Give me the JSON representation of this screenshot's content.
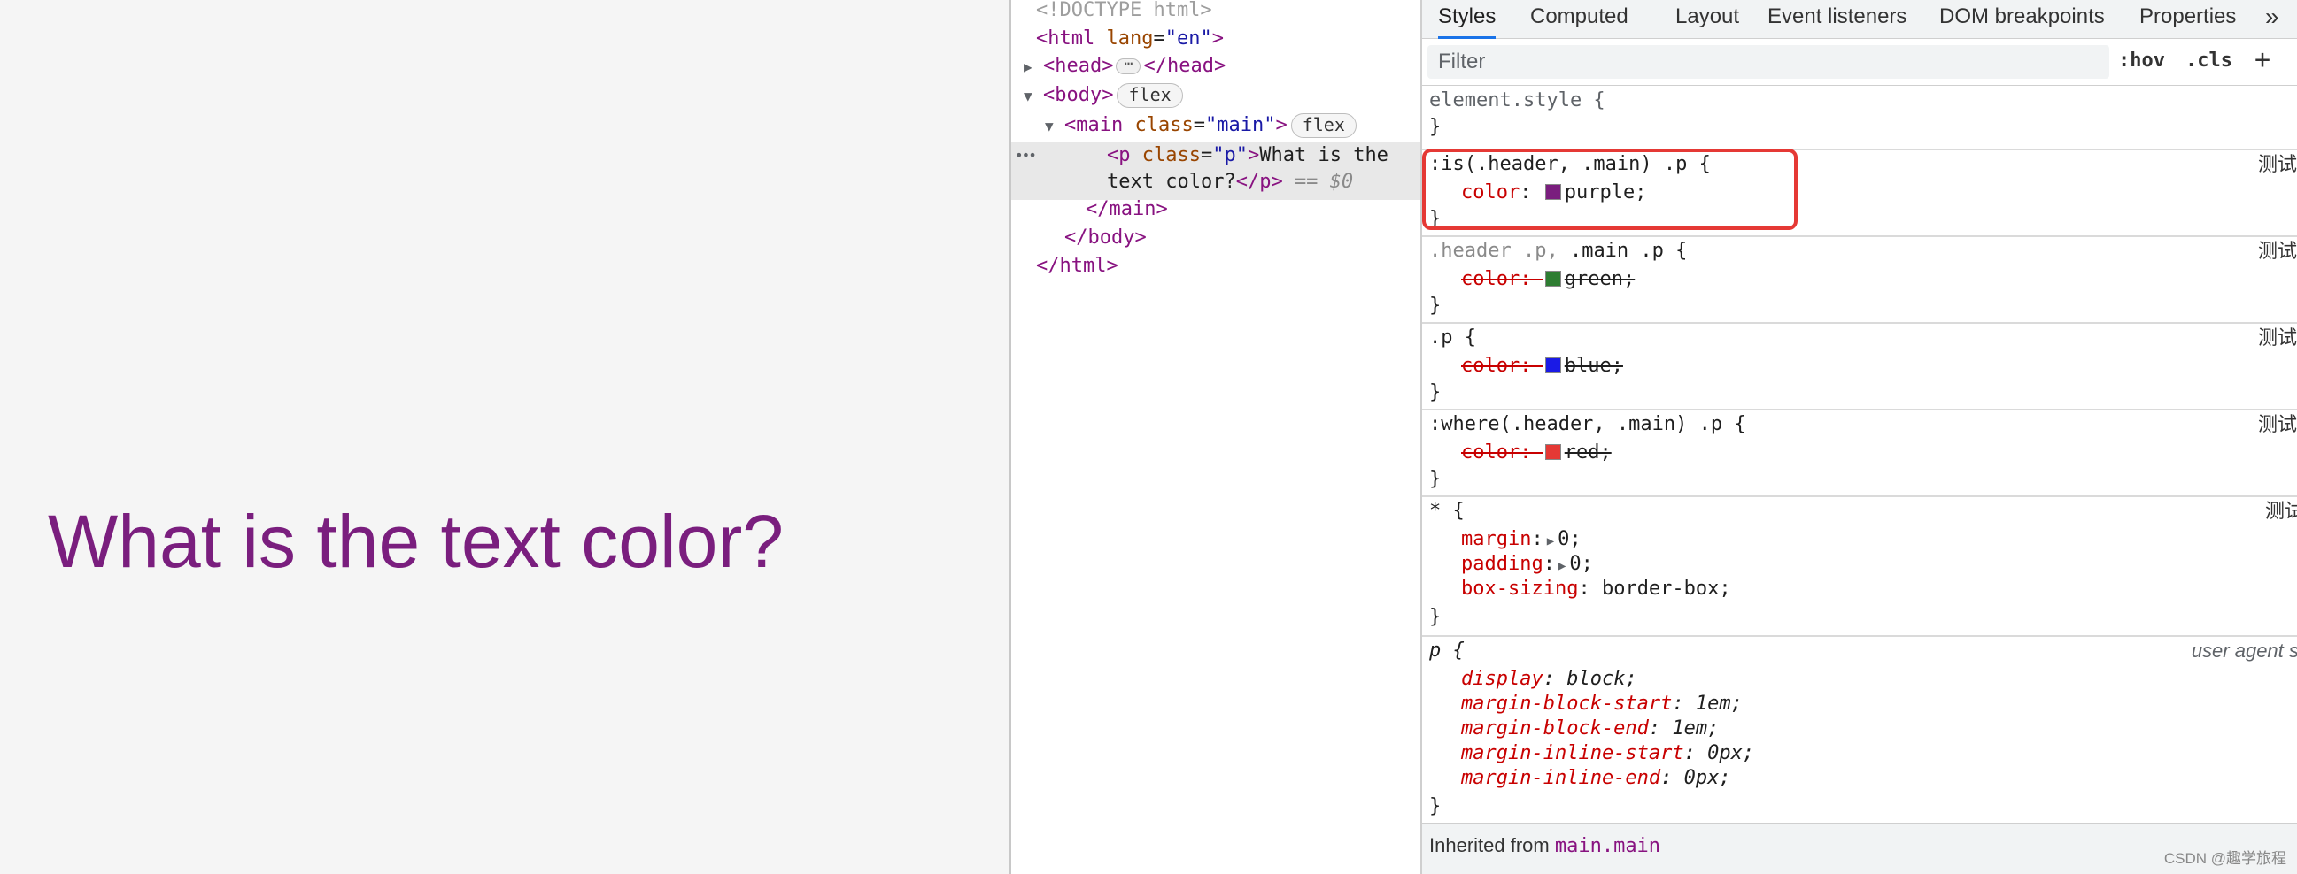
{
  "preview": {
    "text": "What is the text color?",
    "text_color": "#7a1e7e",
    "background": "#f5f5f5"
  },
  "dom_tree": {
    "doctype": "<!DOCTYPE html>",
    "html_open": {
      "tag": "<html",
      "attr": "lang",
      "value": "\"en\"",
      "close": ">"
    },
    "head": {
      "open": "<head>",
      "close": "</head>",
      "ellipsis": "⋯"
    },
    "body": {
      "open": "<body>",
      "badge": "flex"
    },
    "main": {
      "open": "<main",
      "attr": "class",
      "value": "\"main\"",
      "close": ">",
      "badge": "flex"
    },
    "p": {
      "open": "<p",
      "attr": "class",
      "value": "\"p\"",
      "close": ">",
      "text_line1": "What is the",
      "text_line2": "text color?",
      "end_tag": "</p>",
      "dollar": "== $0"
    },
    "row_dots": "•••",
    "main_close": "</main>",
    "body_close": "</body>",
    "html_close": "</html>"
  },
  "styles_panel": {
    "tabs": [
      "Styles",
      "Computed",
      "Layout",
      "Event listeners",
      "DOM breakpoints",
      "Properties"
    ],
    "active_tab": "Styles",
    "more_tabs": "»",
    "filter_placeholder": "Filter",
    "hov_button": ":hov",
    "cls_button": ".cls",
    "add_rule": "+",
    "element_style": {
      "selector": "element.style {",
      "close": "}"
    },
    "rules": [
      {
        "selector": ":is(.header, .main) .p {",
        "source": "测试",
        "property": "color",
        "value": "purple;",
        "swatch": "#7a1e7e",
        "overridden": false,
        "close": "}"
      },
      {
        "selector_dim": ".header .p,",
        "selector": " .main .p {",
        "source": "测试",
        "property": "color",
        "value": "green;",
        "swatch": "#2e7d32",
        "overridden": true,
        "close": "}"
      },
      {
        "selector": ".p {",
        "source": "测试",
        "property": "color",
        "value": "blue;",
        "swatch": "#1a1ae6",
        "overridden": true,
        "close": "}"
      },
      {
        "selector": ":where(.header, .main) .p {",
        "source": "测试",
        "property": "color",
        "value": "red;",
        "swatch": "#e53935",
        "overridden": true,
        "close": "}"
      }
    ],
    "universal_rule": {
      "selector": "* {",
      "source": "测试",
      "props": [
        {
          "property": "margin",
          "value": "0;"
        },
        {
          "property": "padding",
          "value": "0;"
        },
        {
          "property": "box-sizing",
          "value": "border-box;"
        }
      ],
      "close": "}"
    },
    "ua_rule": {
      "selector": "p {",
      "source": "user agent st",
      "props": [
        {
          "property": "display",
          "value": "block;"
        },
        {
          "property": "margin-block-start",
          "value": "1em;"
        },
        {
          "property": "margin-block-end",
          "value": "1em;"
        },
        {
          "property": "margin-inline-start",
          "value": "0px;"
        },
        {
          "property": "margin-inline-end",
          "value": "0px;"
        }
      ],
      "close": "}"
    },
    "inherited": {
      "label": "Inherited from ",
      "selector": "main.main"
    },
    "highlight_color": "#e53935"
  },
  "watermark": "CSDN @趣学旅程"
}
